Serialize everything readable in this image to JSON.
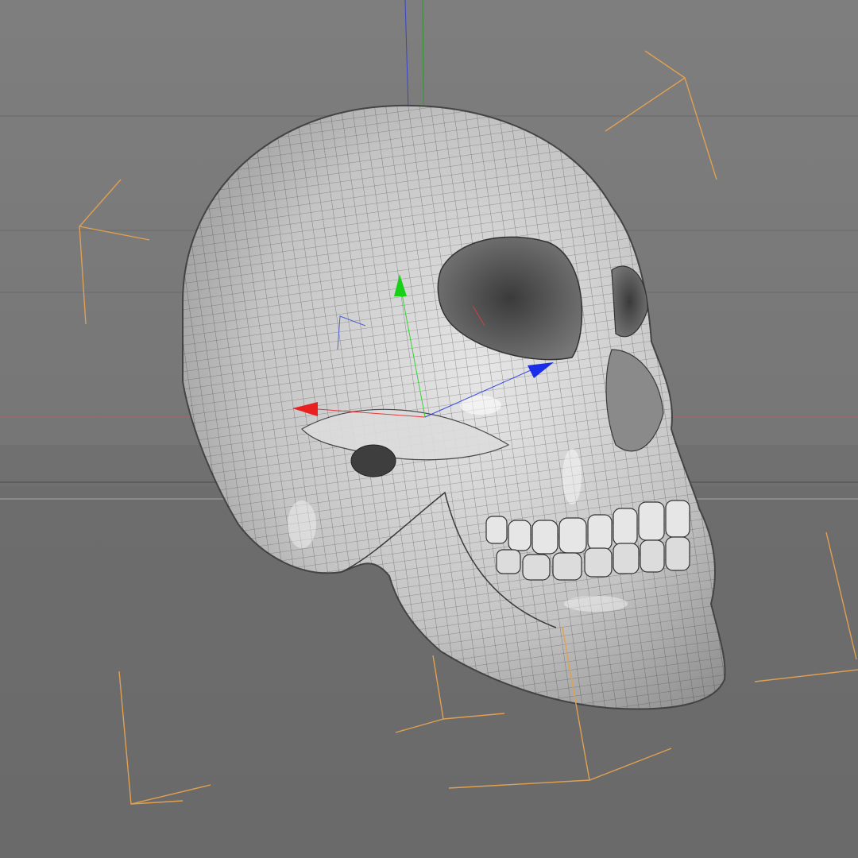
{
  "viewport": {
    "view": "perspective",
    "display_mode": "shaded-wireframe",
    "background_color": "#7a7a7a",
    "horizon_color": "#9a9a9a",
    "wire_color": "#2e2e2e",
    "light_color": "#e0a050"
  },
  "object": {
    "kind": "skull-mesh",
    "surface_color": "#c9c9c9"
  },
  "gizmo": {
    "type": "move-tool",
    "axes": [
      {
        "axis": "x",
        "color": "#e82020"
      },
      {
        "axis": "y",
        "color": "#18d018"
      },
      {
        "axis": "z",
        "color": "#1a2ee8"
      }
    ]
  },
  "lights": [
    {
      "name": "light-left-upper",
      "color": "#e0a050"
    },
    {
      "name": "light-right-upper",
      "color": "#e0a050"
    },
    {
      "name": "light-left-lower",
      "color": "#e0a050"
    },
    {
      "name": "light-center-lower",
      "color": "#e0a050"
    },
    {
      "name": "light-right-lower",
      "color": "#e0a050"
    },
    {
      "name": "light-far-right",
      "color": "#e0a050"
    }
  ]
}
